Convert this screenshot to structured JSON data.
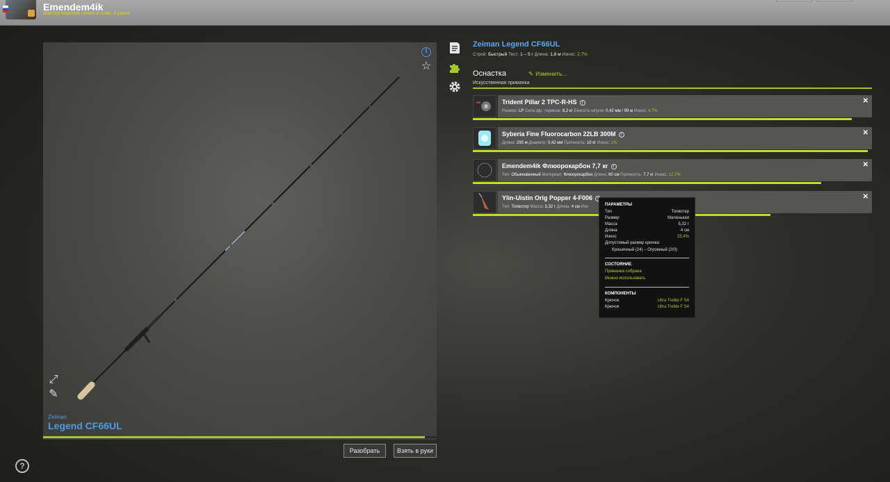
{
  "header": {
    "username": "Emendem4ik",
    "user_title": "Мастер морской ловли в отве: 3 ранга"
  },
  "preview": {
    "brand": "Zeiman",
    "model": "Legend CF66UL",
    "wear_progress": 0.97,
    "buttons": {
      "disassemble": "Разобрать",
      "take": "Взять в руки"
    }
  },
  "rod": {
    "title": "Zeiman Legend CF66UL",
    "stats": [
      {
        "label": "Строй:",
        "value": "Быстрый"
      },
      {
        "label": "Тест:",
        "value": "1 – 5 г"
      },
      {
        "label": "Длина:",
        "value": "1,8 м"
      },
      {
        "label": "Износ:",
        "value": "2,7%",
        "highlight": true
      }
    ]
  },
  "rig": {
    "heading": "Оснастка",
    "edit_label": "Изменить...",
    "type": "Искусственная приманка"
  },
  "items": [
    {
      "name": "Trident Pillar 2 TPC-R-HS",
      "icon": "reel-icon",
      "progress": 0.95,
      "stats": [
        {
          "label": "Размер:",
          "value": "LP"
        },
        {
          "label": "Сила фр. тормоза:",
          "value": "8,2 кг"
        },
        {
          "label": "Емкость шпули:",
          "value": "0,42 мм / 99 м"
        },
        {
          "label": "Износ:",
          "value": "4,7%",
          "highlight": true
        }
      ]
    },
    {
      "name": "Syberia Fine Fluorocarbon 22LB 300M",
      "icon": "line-spool-icon",
      "progress": 0.99,
      "stats": [
        {
          "label": "Длина:",
          "value": "295 м"
        },
        {
          "label": "Диаметр:",
          "value": "0,42 мм"
        },
        {
          "label": "Прочность:",
          "value": "10 кг"
        },
        {
          "label": "Износ:",
          "value": "1%",
          "highlight": true
        }
      ]
    },
    {
      "name": "Emendem4ik Флюорокарбон 7,7 кг",
      "icon": "leader-icon",
      "progress": 0.873,
      "stats": [
        {
          "label": "Тип:",
          "value": "Обыкновенный"
        },
        {
          "label": "Материал:",
          "value": "Флюорокарбон"
        },
        {
          "label": "Длина:",
          "value": "60 см"
        },
        {
          "label": "Прочность:",
          "value": "7,7 кг"
        },
        {
          "label": "Износ:",
          "value": "12,7%",
          "highlight": true
        }
      ]
    },
    {
      "name": "Ylin-Uistin Orig Popper 4-F006",
      "icon": "lure-icon",
      "progress": 0.746,
      "stats": [
        {
          "label": "Тип:",
          "value": "Топвотер"
        },
        {
          "label": "Масса:",
          "value": "5,32 г"
        },
        {
          "label": "Длина:",
          "value": "4 см"
        },
        {
          "label": "Изн",
          "value": ""
        }
      ]
    }
  ],
  "tooltip": {
    "params_heading": "ПАРАМЕТРЫ",
    "params": [
      {
        "label": "Тип",
        "value": "Топвотер"
      },
      {
        "label": "Размер",
        "value": "Маленькая"
      },
      {
        "label": "Масса",
        "value": "5,32 г"
      },
      {
        "label": "Длина",
        "value": "4 см"
      },
      {
        "label": "Износ",
        "value": "25,4%",
        "highlight": true
      }
    ],
    "hook_size_label": "Допустимый размер крючка:",
    "hook_size_value": "Крошечный (24) – Огромный (2/0)",
    "state_heading": "СОСТОЯНИЕ",
    "state_lines": [
      "Приманка собрана",
      "Можно использовать"
    ],
    "components_heading": "КОМПОНЕНТЫ",
    "components": [
      {
        "label": "Крючок",
        "value": "Ultra Treble F S4"
      },
      {
        "label": "Крючок",
        "value": "Ultra Treble F S4"
      }
    ]
  }
}
